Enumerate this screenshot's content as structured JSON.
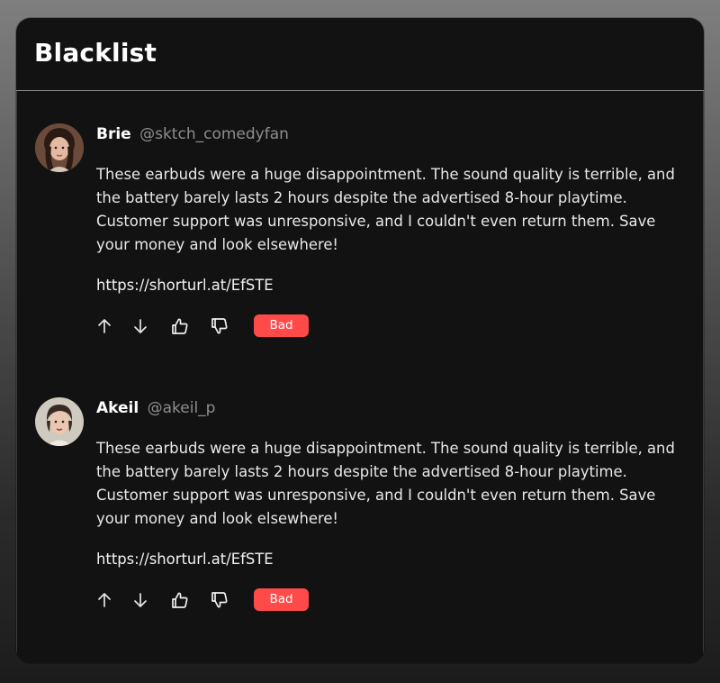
{
  "title": "Blacklist",
  "posts": [
    {
      "name": "Brie",
      "handle": "@sktch_comedyfan",
      "text": "These earbuds were a huge disappointment. The sound quality is terrible, and the battery barely lasts 2 hours despite the advertised 8-hour playtime. Customer support was unresponsive, and I couldn't even return them. Save your money and look elsewhere!",
      "link": "https://shorturl.at/EfSTE",
      "badge": "Bad"
    },
    {
      "name": "Akeil",
      "handle": "@akeil_p",
      "text": "These earbuds were a huge disappointment. The sound quality is terrible, and the battery barely lasts 2 hours despite the advertised 8-hour playtime. Customer support was unresponsive, and I couldn't even return them. Save your money and look elsewhere!",
      "link": "https://shorturl.at/EfSTE",
      "badge": "Bad"
    }
  ],
  "colors": {
    "badge": "#ff4a4a",
    "panel": "#121212",
    "text": "#e8e8e8",
    "handle": "#8e8e8e"
  },
  "icons": [
    "arrow-up-icon",
    "arrow-down-icon",
    "thumbs-up-icon",
    "thumbs-down-icon"
  ]
}
